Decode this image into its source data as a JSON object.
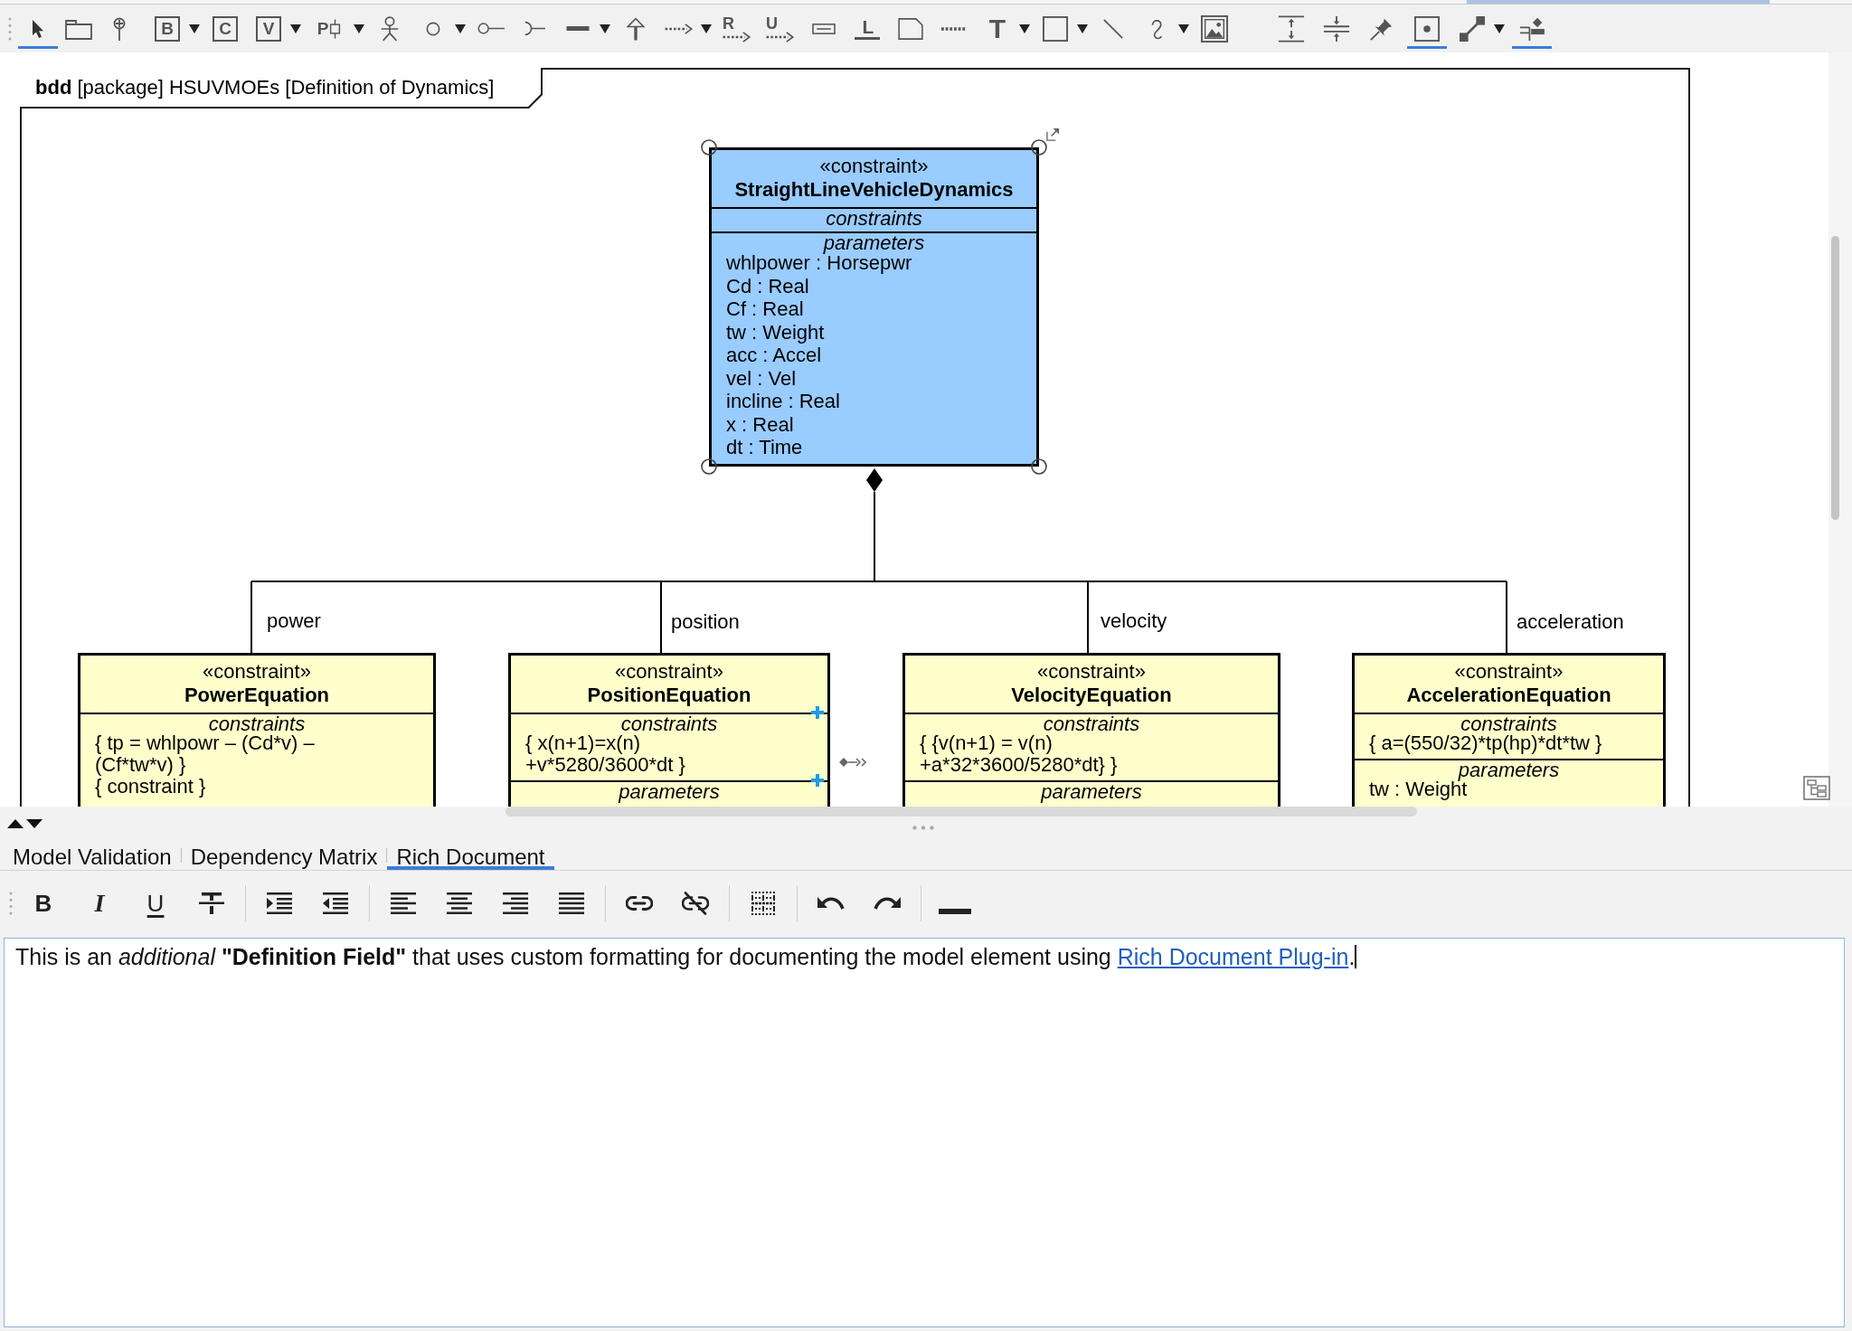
{
  "diagram_toolbar": {
    "groups": [
      [
        {
          "kind": "pointer",
          "selected": true,
          "dropdown": false
        },
        {
          "kind": "package",
          "selected": false,
          "dropdown": false
        },
        {
          "kind": "pin",
          "selected": false,
          "dropdown": false
        }
      ],
      [
        {
          "kind": "boxed-letter",
          "glyph": "B",
          "selected": false,
          "dropdown": true
        },
        {
          "kind": "boxed-letter",
          "glyph": "C",
          "selected": false,
          "dropdown": false
        },
        {
          "kind": "boxed-letter",
          "glyph": "V",
          "selected": false,
          "dropdown": true
        },
        {
          "kind": "port",
          "glyph": "P",
          "selected": false,
          "dropdown": true
        },
        {
          "kind": "actor",
          "selected": false,
          "dropdown": false
        },
        {
          "kind": "circle",
          "selected": false,
          "dropdown": true
        },
        {
          "kind": "lollipop",
          "selected": false,
          "dropdown": false
        },
        {
          "kind": "socket",
          "selected": false,
          "dropdown": false
        },
        {
          "kind": "line",
          "selected": false,
          "dropdown": true
        },
        {
          "kind": "generalization",
          "selected": false,
          "dropdown": false
        },
        {
          "kind": "dashed-arrow",
          "selected": false,
          "dropdown": true
        },
        {
          "kind": "lettered-arrow",
          "glyph": "R",
          "selected": false,
          "dropdown": false
        },
        {
          "kind": "lettered-arrow",
          "glyph": "U",
          "selected": false,
          "dropdown": false
        },
        {
          "kind": "slot",
          "selected": false,
          "dropdown": false
        },
        {
          "kind": "underlined-letter",
          "glyph": "L",
          "selected": false,
          "dropdown": false
        },
        {
          "kind": "note",
          "selected": false,
          "dropdown": false
        },
        {
          "kind": "dotted-line",
          "selected": false,
          "dropdown": false
        },
        {
          "kind": "letter",
          "glyph": "T",
          "selected": false,
          "dropdown": true
        },
        {
          "kind": "rectangle",
          "selected": false,
          "dropdown": true
        },
        {
          "kind": "diagonal-line",
          "selected": false,
          "dropdown": false
        },
        {
          "kind": "curve",
          "selected": false,
          "dropdown": true
        },
        {
          "kind": "image",
          "selected": false,
          "dropdown": false
        }
      ],
      [
        {
          "kind": "expand-vertical",
          "selected": false,
          "dropdown": false
        },
        {
          "kind": "shrink-vertical",
          "selected": false,
          "dropdown": false
        },
        {
          "kind": "pushpin",
          "selected": false,
          "dropdown": false
        },
        {
          "kind": "dot-square",
          "selected": true,
          "dropdown": false
        },
        {
          "kind": "connector",
          "selected": false,
          "dropdown": true
        },
        {
          "kind": "align",
          "selected": true,
          "dropdown": false
        }
      ]
    ]
  },
  "diagram": {
    "frame_title": "**bdd** [package] HSUVMOEs [Definition of Dynamics]",
    "blocks": [
      {
        "stereotype": "«constraint»",
        "name": "StraightLineVehicleDynamics",
        "selected": true,
        "hovered": false,
        "compartments": [
          {
            "title": "constraints"
          },
          {
            "title": "parameters",
            "lines": [
              "whlpower : Horsepwr",
              "Cd : Real",
              "Cf : Real",
              "tw : Weight",
              "acc : Accel",
              "vel : Vel",
              "incline : Real",
              "x : Real",
              "dt : Time"
            ]
          }
        ]
      },
      {
        "stereotype": "«constraint»",
        "name": "PowerEquation",
        "selected": false,
        "hovered": false,
        "compartments": [
          {
            "title": "constraints",
            "lines": [
              "{ tp = whlpowr – (Cd*v) – (Cf*tw*v) }",
              "{ constraint }"
            ]
          }
        ]
      },
      {
        "stereotype": "«constraint»",
        "name": "PositionEquation",
        "selected": false,
        "hovered": true,
        "compartments": [
          {
            "title": "constraints",
            "lines": [
              "{ x(n+1)=x(n) +v*5280/3600*dt }"
            ]
          },
          {
            "title": "parameters"
          }
        ]
      },
      {
        "stereotype": "«constraint»",
        "name": "VelocityEquation",
        "selected": false,
        "hovered": false,
        "compartments": [
          {
            "title": "constraints",
            "lines": [
              "{ {v(n+1) = v(n) +a*32*3600/5280*dt} }"
            ]
          },
          {
            "title": "parameters"
          }
        ]
      },
      {
        "stereotype": "«constraint»",
        "name": "AccelerationEquation",
        "selected": false,
        "hovered": false,
        "compartments": [
          {
            "title": "constraints",
            "lines": [
              "{ a=(550/32)*tp(hp)*dt*tw }"
            ]
          },
          {
            "title": "parameters",
            "lines": [
              "tw : Weight"
            ]
          }
        ]
      }
    ],
    "connectors": [
      {
        "role": "power"
      },
      {
        "role": "position"
      },
      {
        "role": "velocity"
      },
      {
        "role": "acceleration"
      }
    ]
  },
  "bottom_panel": {
    "tabs": [
      {
        "label": "Model Validation",
        "selected": false
      },
      {
        "label": "Dependency Matrix",
        "selected": false
      },
      {
        "label": "Rich Document",
        "selected": true
      }
    ],
    "rich_toolbar": {
      "groups": [
        [
          {
            "kind": "bold",
            "glyph": "B"
          },
          {
            "kind": "italic",
            "glyph": "I"
          },
          {
            "kind": "underline",
            "glyph": "U"
          },
          {
            "kind": "strikethrough"
          }
        ],
        [
          {
            "kind": "indent"
          },
          {
            "kind": "outdent"
          }
        ],
        [
          {
            "kind": "align-left"
          },
          {
            "kind": "align-center"
          },
          {
            "kind": "align-right"
          },
          {
            "kind": "justify"
          }
        ],
        [
          {
            "kind": "link"
          },
          {
            "kind": "unlink"
          }
        ],
        [
          {
            "kind": "table"
          }
        ],
        [
          {
            "kind": "undo"
          },
          {
            "kind": "redo"
          }
        ],
        [
          {
            "kind": "horizontal-rule"
          }
        ]
      ]
    },
    "editor": {
      "focused": true,
      "text": "This is an *additional* **\"Definition Field\"** that uses custom formatting for documenting the model element using ",
      "link": "Rich Document Plug-in",
      "text_after": "."
    }
  }
}
